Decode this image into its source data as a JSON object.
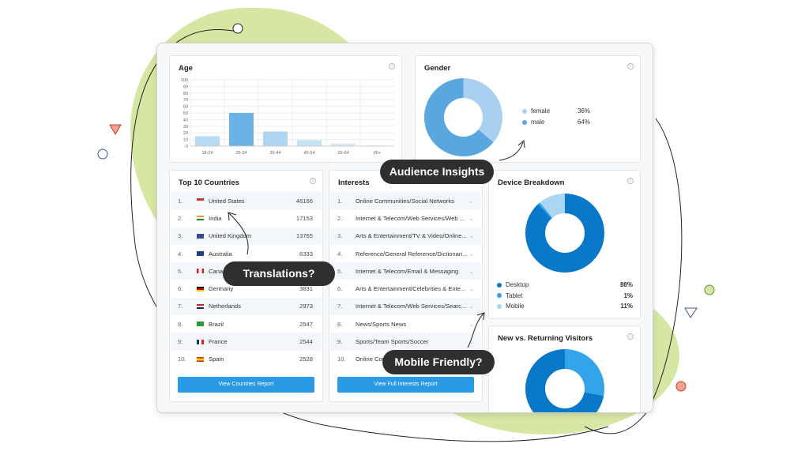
{
  "callouts": {
    "audience": "Audience Insights",
    "translations": "Translations?",
    "mobile": "Mobile Friendly?"
  },
  "age": {
    "title": "Age",
    "chart_data": {
      "type": "bar",
      "categories": [
        "18-24",
        "25-34",
        "35-44",
        "45-54",
        "55-64",
        "65+"
      ],
      "values": [
        15,
        50,
        22,
        9,
        4,
        1
      ],
      "ylim": [
        0,
        100
      ],
      "yticks": [
        "100",
        "90",
        "80",
        "70",
        "60",
        "50",
        "40",
        "30",
        "20",
        "10",
        "0"
      ],
      "grid": true,
      "colors": [
        "#b7dbf5",
        "#6bb3e6",
        "#aed6f3",
        "#c6e2f6",
        "#d3e8f8",
        "#dcedf9"
      ]
    }
  },
  "gender": {
    "title": "Gender",
    "items": [
      {
        "label": "female",
        "value": "36%",
        "pct": 36,
        "color": "#a9d0f1"
      },
      {
        "label": "male",
        "value": "64%",
        "pct": 64,
        "color": "#5aa7e0"
      }
    ]
  },
  "countries": {
    "title": "Top 10 Countries",
    "button": "View Countries Report",
    "items": [
      {
        "n": "1.",
        "name": "United States",
        "value": "46166"
      },
      {
        "n": "2.",
        "name": "India",
        "value": "17153"
      },
      {
        "n": "3.",
        "name": "United Kingdom",
        "value": "13765"
      },
      {
        "n": "4.",
        "name": "Australia",
        "value": "6333"
      },
      {
        "n": "5.",
        "name": "Canada",
        "value": ""
      },
      {
        "n": "6.",
        "name": "Germany",
        "value": "3831"
      },
      {
        "n": "7.",
        "name": "Netherlands",
        "value": "2973"
      },
      {
        "n": "8.",
        "name": "Brazil",
        "value": "2547"
      },
      {
        "n": "9.",
        "name": "France",
        "value": "2544"
      },
      {
        "n": "10.",
        "name": "Spain",
        "value": "2528"
      }
    ]
  },
  "interests": {
    "title": "Interests",
    "button": "View Full Interests Report",
    "items": [
      {
        "n": "1.",
        "name": "Online Communities/Social Networks"
      },
      {
        "n": "2.",
        "name": "Internet & Telecom/Web Services/Web ..."
      },
      {
        "n": "3.",
        "name": "Arts & Entertainment/TV & Video/Online..."
      },
      {
        "n": "4.",
        "name": "Reference/General Reference/Dictionari..."
      },
      {
        "n": "5.",
        "name": "Internet & Telecom/Email & Messaging"
      },
      {
        "n": "6.",
        "name": "Arts & Entertainment/Celebrities & Ente..."
      },
      {
        "n": "7.",
        "name": "Internet & Telecom/Web Services/Searc..."
      },
      {
        "n": "8.",
        "name": "News/Sports News"
      },
      {
        "n": "9.",
        "name": "Sports/Team Sports/Soccer"
      },
      {
        "n": "10.",
        "name": "Online Com"
      }
    ]
  },
  "device": {
    "title": "Device Breakdown",
    "items": [
      {
        "label": "Desktop",
        "value": "88%",
        "pct": 88,
        "color": "#0a78c8"
      },
      {
        "label": "Tablet",
        "value": "1%",
        "pct": 1,
        "color": "#2fa3e6"
      },
      {
        "label": "Mobile",
        "value": "11%",
        "pct": 11,
        "color": "#a9d6f5"
      }
    ]
  },
  "visitors": {
    "title": "New vs. Returning Visitors",
    "segments": [
      {
        "pct": 28,
        "color": "#33a4ea"
      },
      {
        "pct": 72,
        "color": "#0a78c8"
      }
    ]
  }
}
